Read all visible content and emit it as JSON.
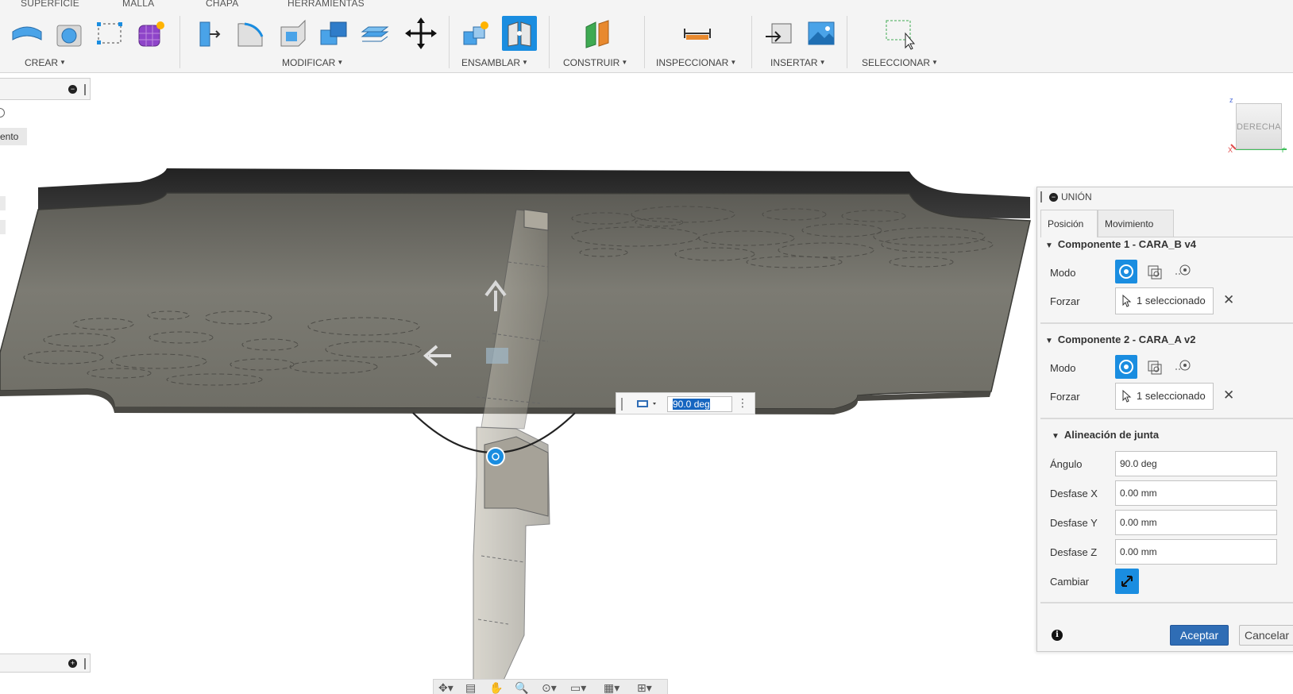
{
  "toolbar": {
    "tabs": [
      "SUPERFICIE",
      "MALLA",
      "CHAPA",
      "HERRAMIENTAS"
    ],
    "groups": {
      "crear": "CREAR",
      "modificar": "MODIFICAR",
      "ensamblar": "ENSAMBLAR",
      "construir": "CONSTRUIR",
      "inspeccionar": "INSPECCIONAR",
      "insertar": "INSERTAR",
      "seleccionar": "SELECCIONAR"
    },
    "icons": [
      "extrude-icon",
      "revolve-icon",
      "sketch-icon",
      "form-icon",
      "press-pull-icon",
      "fillet-icon",
      "shell-icon",
      "combine-icon",
      "offset-face-icon",
      "move-icon",
      "new-component-icon",
      "joint-icon",
      "construct-plane-icon",
      "measure-icon",
      "insert-mesh-icon",
      "insert-image-icon",
      "select-box-icon"
    ],
    "accent": "#1a8de0"
  },
  "browser": {
    "partial_label": "ento"
  },
  "viewport": {
    "view_cube_face": "DERECHA",
    "angle_input": "90.0 deg"
  },
  "dialog": {
    "title": "UNIÓN",
    "tabs": [
      "Posición",
      "Movimiento"
    ],
    "component1": {
      "header": "Componente 1 - CARA_B v4",
      "mode_label": "Modo",
      "force_label": "Forzar",
      "selection": "1 seleccionado"
    },
    "component2": {
      "header": "Componente 2 - CARA_A v2",
      "mode_label": "Modo",
      "force_label": "Forzar",
      "selection": "1 seleccionado"
    },
    "alignment": {
      "header": "Alineación de junta",
      "angle_label": "Ángulo",
      "angle": "90.0 deg",
      "offset_x_label": "Desfase X",
      "offset_x": "0.00 mm",
      "offset_y_label": "Desfase Y",
      "offset_y": "0.00 mm",
      "offset_z_label": "Desfase Z",
      "offset_z": "0.00 mm",
      "flip_label": "Cambiar"
    },
    "ok": "Aceptar",
    "cancel": "Cancelar"
  }
}
